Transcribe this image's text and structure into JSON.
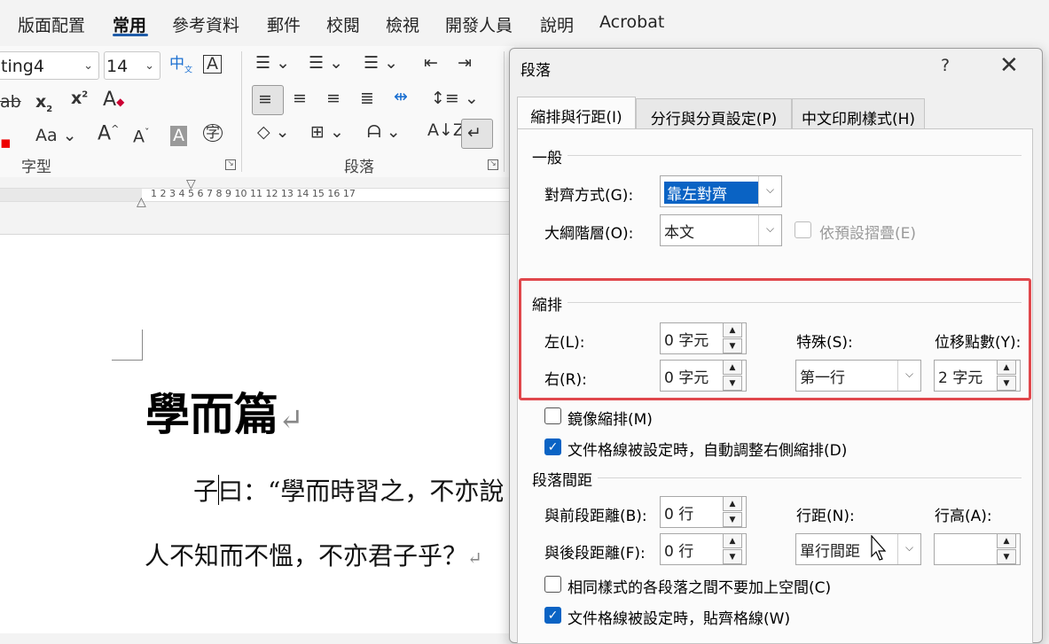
{
  "menu": {
    "items": [
      "版面配置",
      "常用",
      "參考資料",
      "郵件",
      "校閱",
      "檢視",
      "開發人員",
      "說明",
      "Acrobat"
    ],
    "active": "常用"
  },
  "ribbon": {
    "style_value": "ting4",
    "size_value": "14",
    "font_group_label": "字型",
    "paragraph_group_label": "段落"
  },
  "ruler": {
    "numbers": "1  2  3  4  5  6  7  8  9  10  11  12  13  14  15  16  17"
  },
  "document": {
    "title": "學而篇",
    "line1": "子曰：“學而時習之，不亦說",
    "line2": "人不知而不慍，不亦君子乎？"
  },
  "dialog": {
    "title": "段落",
    "help": "?",
    "close": "✕",
    "tabs": [
      "縮排與行距(I)",
      "分行與分頁設定(P)",
      "中文印刷樣式(H)"
    ],
    "general": {
      "heading": "一般",
      "alignment_label": "對齊方式(G):",
      "alignment_value": "靠左對齊",
      "outline_label": "大綱階層(O):",
      "outline_value": "本文",
      "collapse_label": "依預設摺疊(E)"
    },
    "indent": {
      "heading": "縮排",
      "left_label": "左(L):",
      "left_value": "0 字元",
      "right_label": "右(R):",
      "right_value": "0 字元",
      "special_label": "特殊(S):",
      "special_value": "第一行",
      "by_label": "位移點數(Y):",
      "by_value": "2 字元",
      "mirror_label": "鏡像縮排(M)",
      "auto_adjust_label": "文件格線被設定時，自動調整右側縮排(D)"
    },
    "spacing": {
      "heading": "段落間距",
      "before_label": "與前段距離(B):",
      "before_value": "0 行",
      "after_label": "與後段距離(F):",
      "after_value": "0 行",
      "line_spacing_label": "行距(N):",
      "line_spacing_value": "單行間距",
      "at_label": "行高(A):",
      "at_value": "",
      "no_space_label": "相同樣式的各段落之間不要加上空間(C)",
      "snap_grid_label": "文件格線被設定時，貼齊格線(W)"
    }
  },
  "colors": {
    "accent": "#0a63c4",
    "highlight": "#e0474c"
  }
}
